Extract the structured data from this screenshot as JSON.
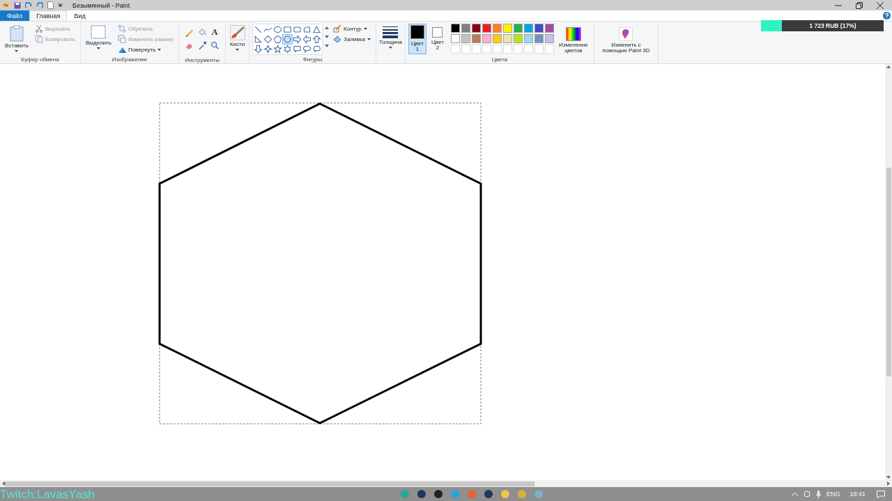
{
  "window": {
    "title": "Безымянный - Paint"
  },
  "tabs": [
    {
      "label": "Файл",
      "selected": false,
      "kind": "file"
    },
    {
      "label": "Главная",
      "selected": true,
      "kind": "tab"
    },
    {
      "label": "Вид",
      "selected": false,
      "kind": "tab"
    }
  ],
  "ribbon": [
    {
      "kind": "clipboard",
      "label": "Буфер обмена",
      "large": "Вставить",
      "small": [
        {
          "label": "Вырезать",
          "disabled": true,
          "kind": "cut"
        },
        {
          "label": "Копировать",
          "disabled": true,
          "kind": "copy"
        }
      ]
    },
    {
      "kind": "image",
      "label": "Изображение",
      "large": "Выделить",
      "small": [
        {
          "label": "Обрезать",
          "disabled": true,
          "kind": "crop"
        },
        {
          "label": "Изменить размер",
          "disabled": true,
          "kind": "resize"
        },
        {
          "label": "Повернуть",
          "disabled": false,
          "kind": "rotate"
        }
      ]
    },
    {
      "kind": "tools",
      "label": "Инструменты",
      "tools": [
        {
          "kind": "pencil"
        },
        {
          "kind": "fill"
        },
        {
          "kind": "text",
          "glyph": "A"
        },
        {
          "kind": "eraser"
        },
        {
          "kind": "picker"
        },
        {
          "kind": "magnifier"
        }
      ]
    },
    {
      "kind": "brushes",
      "label": "Кисти"
    },
    {
      "kind": "shapes",
      "label": "Фигуры",
      "outline": "Контур",
      "fill": "Заливка",
      "shapes": [
        {
          "kind": "line",
          "selected": false
        },
        {
          "kind": "curve",
          "selected": false
        },
        {
          "kind": "oval",
          "selected": false
        },
        {
          "kind": "rect",
          "selected": false
        },
        {
          "kind": "roundrect",
          "selected": false
        },
        {
          "kind": "polygon",
          "selected": false
        },
        {
          "kind": "triangle",
          "selected": false
        },
        {
          "kind": "right-triangle",
          "selected": false
        },
        {
          "kind": "diamond",
          "selected": false
        },
        {
          "kind": "pentagon",
          "selected": false
        },
        {
          "kind": "hexagon",
          "selected": true
        },
        {
          "kind": "right-arrow",
          "selected": false
        },
        {
          "kind": "left-arrow",
          "selected": false
        },
        {
          "kind": "up-arrow",
          "selected": false
        },
        {
          "kind": "down-arrow",
          "selected": false
        },
        {
          "kind": "star4",
          "selected": false
        },
        {
          "kind": "star5",
          "selected": false
        },
        {
          "kind": "star6",
          "selected": false
        },
        {
          "kind": "callout-rect",
          "selected": false
        },
        {
          "kind": "callout-oval",
          "selected": false
        },
        {
          "kind": "callout-cloud",
          "selected": false
        }
      ]
    },
    {
      "kind": "thickness",
      "label": "Толщина"
    },
    {
      "kind": "colors",
      "label": "Цвета",
      "color1": {
        "label": "Цвет 1",
        "color": "#000000",
        "selected": true
      },
      "color2": {
        "label": "Цвет 2",
        "color": "#ffffff",
        "selected": false
      },
      "palette": [
        {
          "color": "#000000"
        },
        {
          "color": "#7f7f7f"
        },
        {
          "color": "#880015"
        },
        {
          "color": "#ed1c24"
        },
        {
          "color": "#ff7f27"
        },
        {
          "color": "#fff200"
        },
        {
          "color": "#22b14c"
        },
        {
          "color": "#00a2e8"
        },
        {
          "color": "#3f48cc"
        },
        {
          "color": "#a349a4"
        },
        {
          "color": "#ffffff"
        },
        {
          "color": "#c3c3c3"
        },
        {
          "color": "#b97a57"
        },
        {
          "color": "#ffaec9"
        },
        {
          "color": "#ffc90e"
        },
        {
          "color": "#efe4b0"
        },
        {
          "color": "#b5e61d"
        },
        {
          "color": "#99d9ea"
        },
        {
          "color": "#7092be"
        },
        {
          "color": "#c8bfe7"
        }
      ],
      "edit_colors": "Изменение цветов"
    },
    {
      "kind": "paint3d",
      "label": "Изменить с помощью Paint 3D"
    }
  ],
  "donation_bar": {
    "text": "1 723 RUB (17%)",
    "level": 0.17
  },
  "stream_caption": "Twitch:LavasYash",
  "taskbar": {
    "language": "ENG",
    "time": "18:41"
  }
}
